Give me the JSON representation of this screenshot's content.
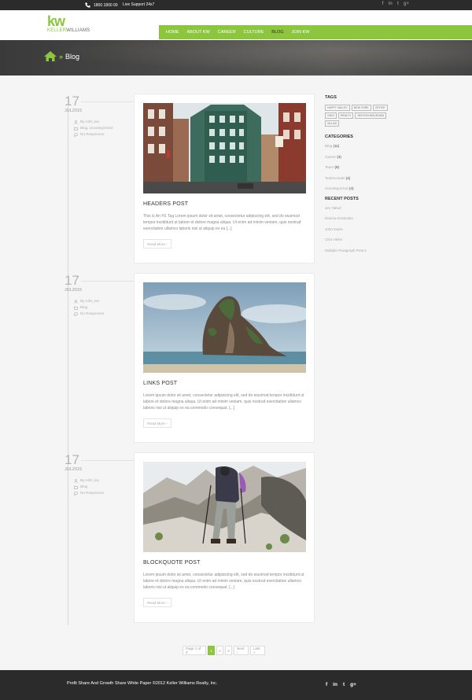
{
  "topbar": {
    "phone": "1800 1800 00",
    "support": "Live Support 24x7",
    "social": [
      "f",
      "in",
      "t",
      "g+"
    ]
  },
  "header": {
    "logo_mark": "kw",
    "logo_first": "KELLER",
    "logo_second": "WILLIAMS",
    "nav": [
      "HOME",
      "ABOUT KW",
      "CAREER",
      "CULTURE",
      "BLOG",
      "JOIN KW"
    ],
    "active_nav": "BLOG",
    "accent": "#8cc63f"
  },
  "banner": {
    "sep": "»",
    "title": "Blog"
  },
  "posts": [
    {
      "day": "17",
      "month": "JUL2015",
      "author": "By Adm_kw",
      "categories": "Blog, Uncategorized",
      "comments": "No Responses",
      "title": "HEADERS POST",
      "excerpt": "This Is An H1 Tag Lorem ipsum dolor sit amet, consectetur adipiscing elit, sed do eiusmod tempor incididunt ut labore et dolore magna aliqua. Ut enim ad minim veniam, quis nostrud exercitation ullamco laboris nisi ut aliquip ex ea [...]",
      "read_more": "Read More",
      "image": "city-street"
    },
    {
      "day": "17",
      "month": "JUL2015",
      "author": "By Adm_kw",
      "categories": "Blog",
      "comments": "No Responses",
      "title": "LINKS POST",
      "excerpt": "Lorem ipsum dolor sit amet, consectetur adipisicing elit, sed do eiusmod tempor incididunt ut labore et dolore magna aliqua. Ut enim ad minim veniam, quis nostrud exercitation ullamco laboris nisi ut aliquip ex ea commodo consequat. [...]",
      "read_more": "Read More",
      "image": "rock-island"
    },
    {
      "day": "17",
      "month": "JUL2015",
      "author": "By Adm_kw",
      "categories": "Blog",
      "comments": "No Responses",
      "title": "BLOCKQUOTE POST",
      "excerpt": "Lorem ipsum dolor sit amet, consectetur adipisicing elit, sed do eiusmod tempor incididunt ut labore et dolore magna aliqua. Ut enim ad minim veniam, quis nostrud exercitation ullamco laboris nisi ut aliquip ex ea commodo consequat. [...]",
      "read_more": "Read More",
      "image": "hiker"
    }
  ],
  "sidebar": {
    "tags_heading": "TAGS",
    "tags": [
      "HAPPY VALLEY",
      "NEW YORK",
      "OFFICE",
      "OHIO",
      "REALTY",
      "SEXTON MOUNTAIN",
      "VILLAS"
    ],
    "categories_heading": "CATEGORIES",
    "categories": [
      {
        "name": "Blog",
        "count": "(11)"
      },
      {
        "name": "Career",
        "count": "(4)"
      },
      {
        "name": "Team",
        "count": "(8)"
      },
      {
        "name": "Testimonials",
        "count": "(4)"
      },
      {
        "name": "Uncategorized",
        "count": "(4)"
      }
    ],
    "recent_heading": "RECENT POSTS",
    "recent": [
      "Jim Talbot",
      "Dianna Kostiuska",
      "John Davis",
      "Clint Heiler",
      "Multiple Paragraph Post 2"
    ]
  },
  "pagination": {
    "label": "Page 1 of 4",
    "pages": [
      "1",
      "2",
      "3"
    ],
    "current": "1",
    "next": "Next ›",
    "last": "Last »"
  },
  "footer": {
    "copyright": "Profit Share And Growth Share White Paper ©2012 Keller Williams Realty, Inc.",
    "social": [
      "f",
      "in",
      "t",
      "g+"
    ]
  }
}
